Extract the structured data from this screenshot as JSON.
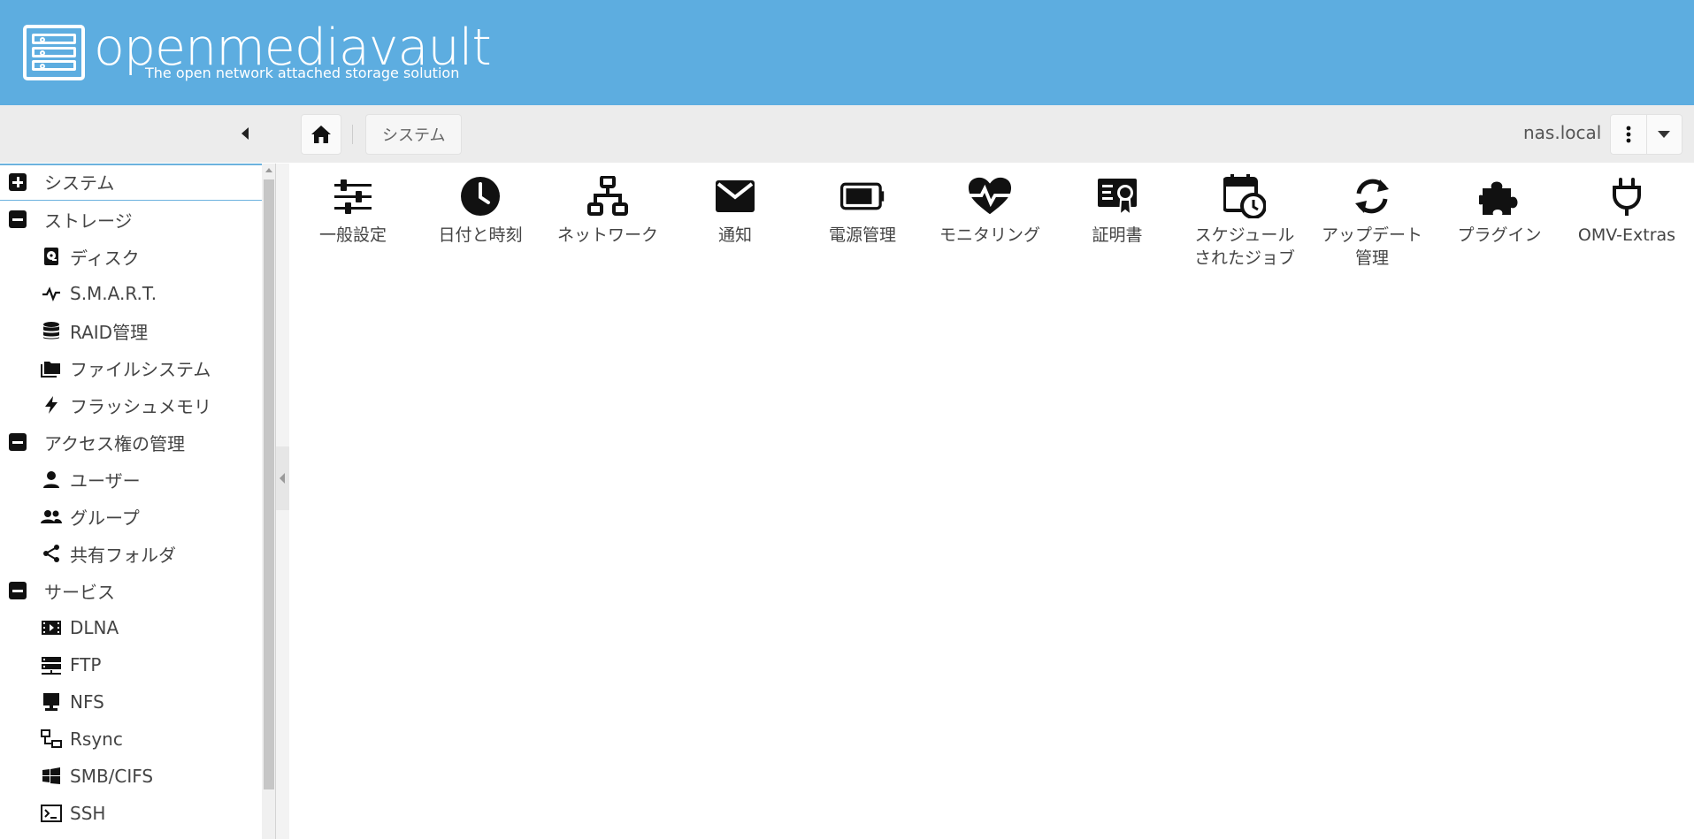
{
  "header": {
    "brand": "openmediavault",
    "tagline": "The open network attached storage solution"
  },
  "toolbar": {
    "breadcrumb": "システム",
    "hostname": "nas.local"
  },
  "sidebar": {
    "items": [
      {
        "type": "group",
        "label": "システム",
        "state": "collapsed",
        "active": true
      },
      {
        "type": "group",
        "label": "ストレージ",
        "state": "expanded"
      },
      {
        "type": "child",
        "label": "ディスク",
        "icon": "disk-icon"
      },
      {
        "type": "child",
        "label": "S.M.A.R.T.",
        "icon": "pulse-icon"
      },
      {
        "type": "child",
        "label": "RAID管理",
        "icon": "database-icon"
      },
      {
        "type": "child",
        "label": "ファイルシステム",
        "icon": "folders-icon"
      },
      {
        "type": "child",
        "label": "フラッシュメモリ",
        "icon": "flash-icon"
      },
      {
        "type": "group",
        "label": "アクセス権の管理",
        "state": "expanded"
      },
      {
        "type": "child",
        "label": "ユーザー",
        "icon": "user-icon"
      },
      {
        "type": "child",
        "label": "グループ",
        "icon": "group-icon"
      },
      {
        "type": "child",
        "label": "共有フォルダ",
        "icon": "share-icon"
      },
      {
        "type": "group",
        "label": "サービス",
        "state": "expanded"
      },
      {
        "type": "child",
        "label": "DLNA",
        "icon": "film-icon"
      },
      {
        "type": "child",
        "label": "FTP",
        "icon": "server-icon"
      },
      {
        "type": "child",
        "label": "NFS",
        "icon": "monitor-icon"
      },
      {
        "type": "child",
        "label": "Rsync",
        "icon": "lan-icon"
      },
      {
        "type": "child",
        "label": "SMB/CIFS",
        "icon": "windows-icon"
      },
      {
        "type": "child",
        "label": "SSH",
        "icon": "terminal-icon"
      }
    ]
  },
  "tiles": [
    {
      "label": "一般設定",
      "icon": "sliders-icon"
    },
    {
      "label": "日付と時刻",
      "icon": "clock-icon"
    },
    {
      "label": "ネットワーク",
      "icon": "network-icon"
    },
    {
      "label": "通知",
      "icon": "mail-icon"
    },
    {
      "label": "電源管理",
      "icon": "battery-icon"
    },
    {
      "label": "モニタリング",
      "icon": "heart-pulse-icon"
    },
    {
      "label": "証明書",
      "icon": "certificate-icon"
    },
    {
      "label": "スケジュール\nされたジョブ",
      "icon": "calendar-clock-icon"
    },
    {
      "label": "アップデート\n管理",
      "icon": "refresh-icon"
    },
    {
      "label": "プラグイン",
      "icon": "puzzle-icon"
    },
    {
      "label": "OMV-Extras",
      "icon": "plug-icon"
    }
  ],
  "colors": {
    "header": "#5dade0",
    "toolbar": "#ececec",
    "active_border": "#6cb2de"
  }
}
